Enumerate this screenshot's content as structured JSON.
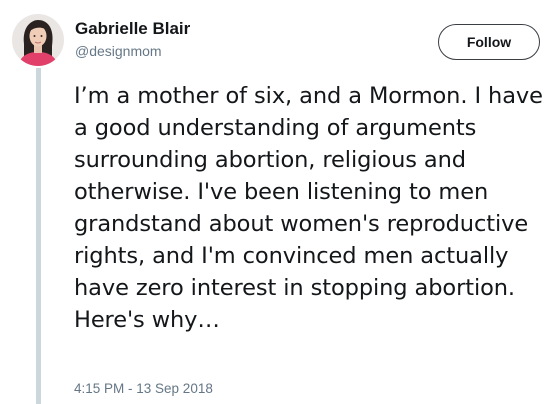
{
  "author": {
    "display_name": "Gabrielle Blair",
    "handle": "@designmom"
  },
  "follow_button": {
    "label": "Follow"
  },
  "tweet": {
    "text": "I’m a mother of six, and a Mormon. I have a good understanding of arguments surrounding abortion, religious and otherwise. I've been listening to men grandstand about women's reproductive rights, and I'm convinced men actually have zero interest in stopping abortion. Here's why…",
    "timestamp": "4:15 PM - 13 Sep 2018"
  },
  "colors": {
    "primary_text": "#14171a",
    "secondary_text": "#657786",
    "thread_line": "#ccd6dd",
    "avatar_shirt": "#e0406a"
  }
}
